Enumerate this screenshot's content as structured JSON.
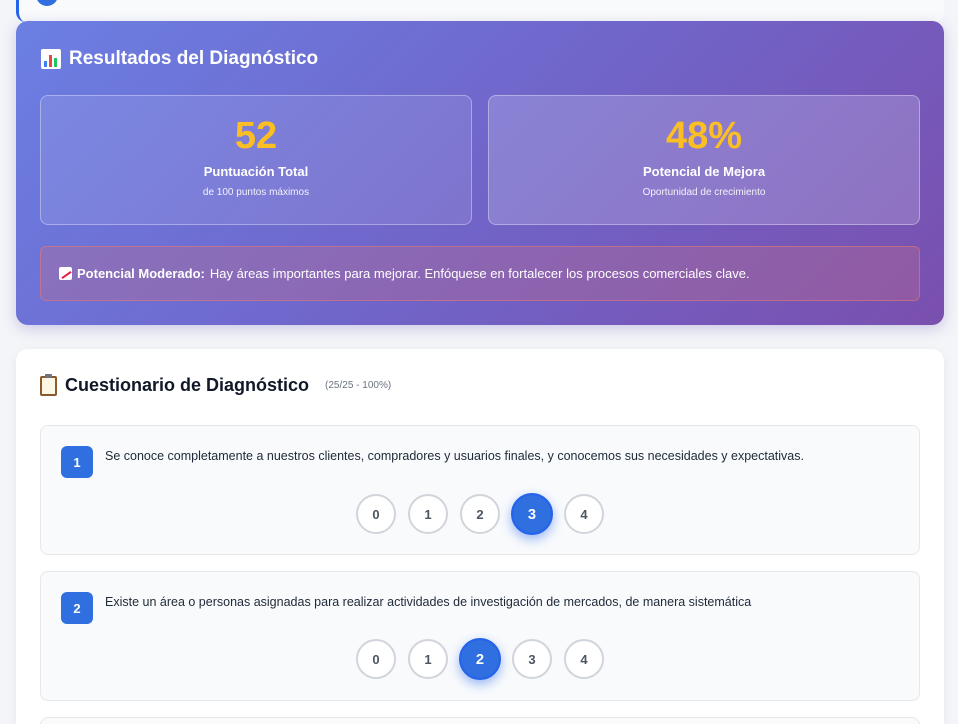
{
  "results": {
    "title": "Resultados del Diagnóstico",
    "score": {
      "value": "52",
      "label": "Puntuación Total",
      "sub": "de 100 puntos máximos"
    },
    "potential": {
      "value": "48%",
      "label": "Potencial de Mejora",
      "sub": "Oportunidad de crecimiento"
    },
    "alert": {
      "strong": "Potencial Moderado:",
      "text": "Hay áreas importantes para mejorar. Enfóquese en fortalecer los procesos comerciales clave."
    }
  },
  "questionnaire": {
    "title": "Cuestionario de Diagnóstico",
    "progress": "(25/25 - 100%)",
    "questions": [
      {
        "number": "1",
        "text": "Se conoce completamente a nuestros clientes, compradores y usuarios finales, y conocemos sus necesidades y expectativas.",
        "options": [
          "0",
          "1",
          "2",
          "3",
          "4"
        ],
        "selected": "3"
      },
      {
        "number": "2",
        "text": "Existe un área o personas asignadas para realizar actividades de investigación de mercados, de manera sistemática",
        "options": [
          "0",
          "1",
          "2",
          "3",
          "4"
        ],
        "selected": "2"
      }
    ]
  },
  "colors": {
    "accent": "#2f6fe0",
    "score": "#fbbf24",
    "gradient_start": "#6b7fe3",
    "gradient_end": "#7a4fae"
  }
}
